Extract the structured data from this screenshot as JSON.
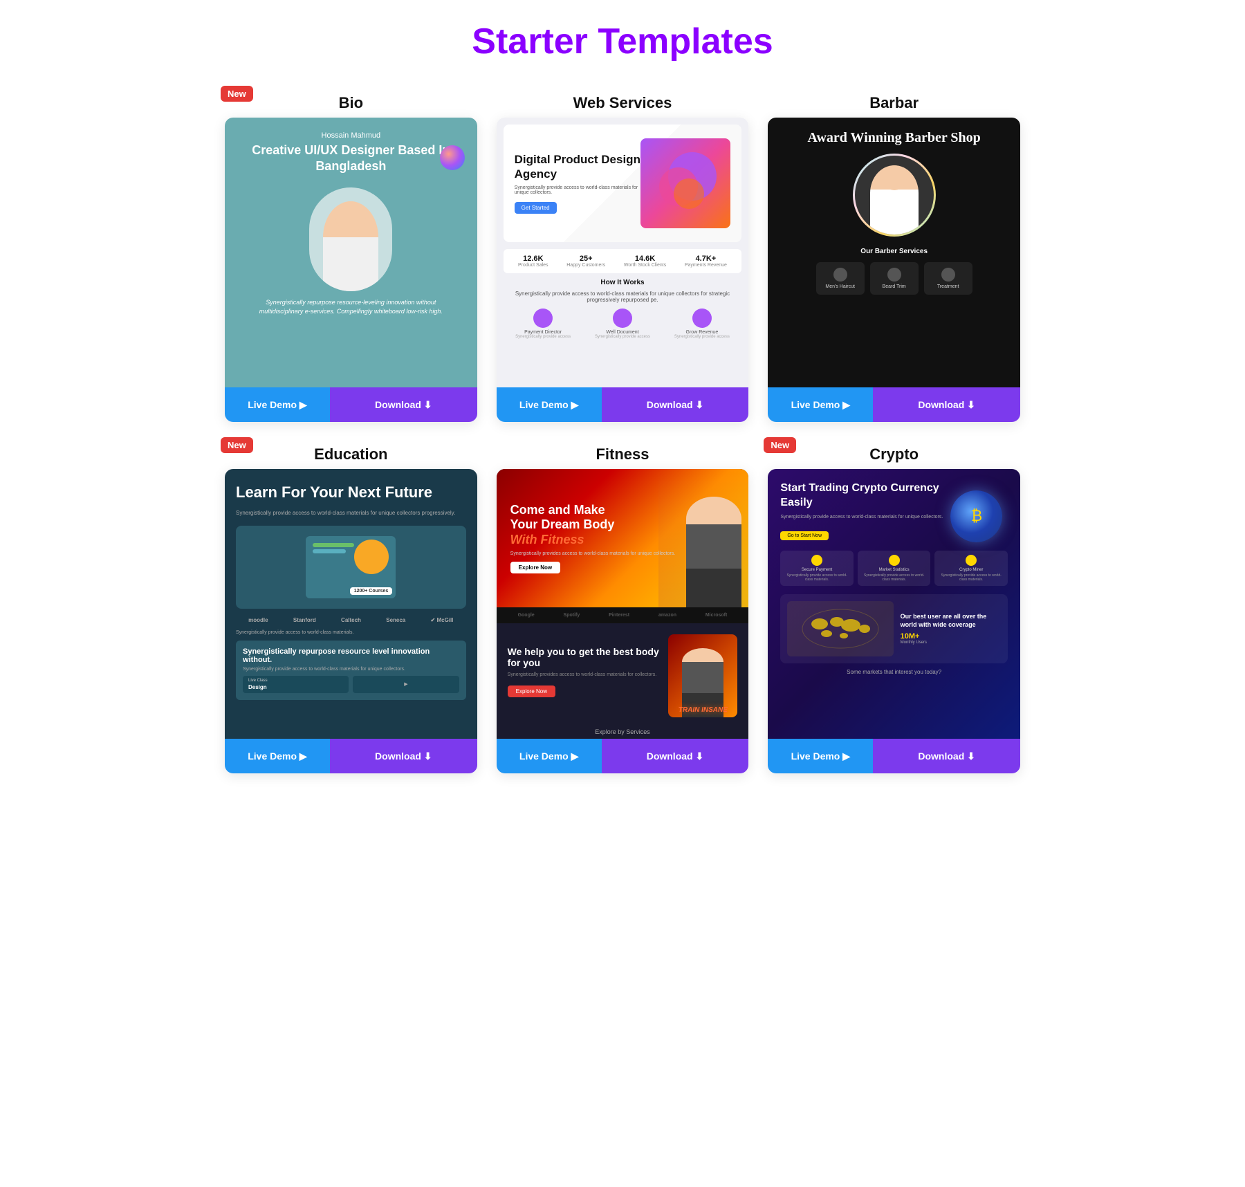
{
  "page": {
    "title": "Starter Templates"
  },
  "templates": [
    {
      "id": "bio",
      "title": "Bio",
      "is_new": true,
      "live_label": "Live Demo ▶",
      "download_label": "Download ⬇",
      "preview": {
        "person_name": "Hossain Mahmud",
        "headline": "Creative UI/UX Designer Based In Bangladesh",
        "description": "Synergistically repurpose resource-leveling innovation without multidisciplinary e-services. Compellingly whiteboard low-risk high."
      }
    },
    {
      "id": "web-services",
      "title": "Web Services",
      "is_new": false,
      "live_label": "Live Demo ▶",
      "download_label": "Download ⬇",
      "preview": {
        "hero_title": "Digital Product Design Agency",
        "stats": [
          "12.6K",
          "25+",
          "14.6K",
          "4.7K+"
        ],
        "stat_labels": [
          "Product Sales",
          "Happy Customers",
          "Worth Stock Clients",
          "Payments Revenue"
        ],
        "how_it_works": "How It Works",
        "service_labels": [
          "Payment Director",
          "Well Document",
          "Grow Revenue"
        ]
      }
    },
    {
      "id": "barbar",
      "title": "Barbar",
      "is_new": false,
      "live_label": "Live Demo ▶",
      "download_label": "Download ⬇",
      "preview": {
        "headline": "Award Winning Barber Shop",
        "services_title": "Our Barber Services",
        "services": [
          "Men's Haircut",
          "Beard Trim",
          "Treatment"
        ]
      }
    },
    {
      "id": "education",
      "title": "Education",
      "is_new": true,
      "live_label": "Live Demo ▶",
      "download_label": "Download ⬇",
      "preview": {
        "headline": "Learn For Your Next Future",
        "logos": [
          "moodle",
          "Stanford",
          "Caltech",
          "Seneca",
          "McGill"
        ],
        "courses": "1200+ Courses"
      }
    },
    {
      "id": "fitness",
      "title": "Fitness",
      "is_new": false,
      "live_label": "Live Demo ▶",
      "download_label": "Download ⬇",
      "preview": {
        "hero_title": "Come and Make Your Dream Body",
        "hero_sub": "With Fitness",
        "logos": [
          "Google",
          "Spotify",
          "Pinterest",
          "amazon",
          "Microsoft"
        ],
        "bottom_title": "We help you to get the best body for you",
        "explore": "Explore by Services"
      }
    },
    {
      "id": "crypto",
      "title": "Crypto",
      "is_new": true,
      "live_label": "Live Demo ▶",
      "download_label": "Download ⬇",
      "preview": {
        "headline": "Start Trading Crypto Currency Easily",
        "cta": "Go to Start Now",
        "cards": [
          "Secure Payment",
          "Market Statistics",
          "Crypto Miner"
        ],
        "map_text": "Our best user are all over the world with wide coverage",
        "users": "10M+"
      }
    }
  ]
}
